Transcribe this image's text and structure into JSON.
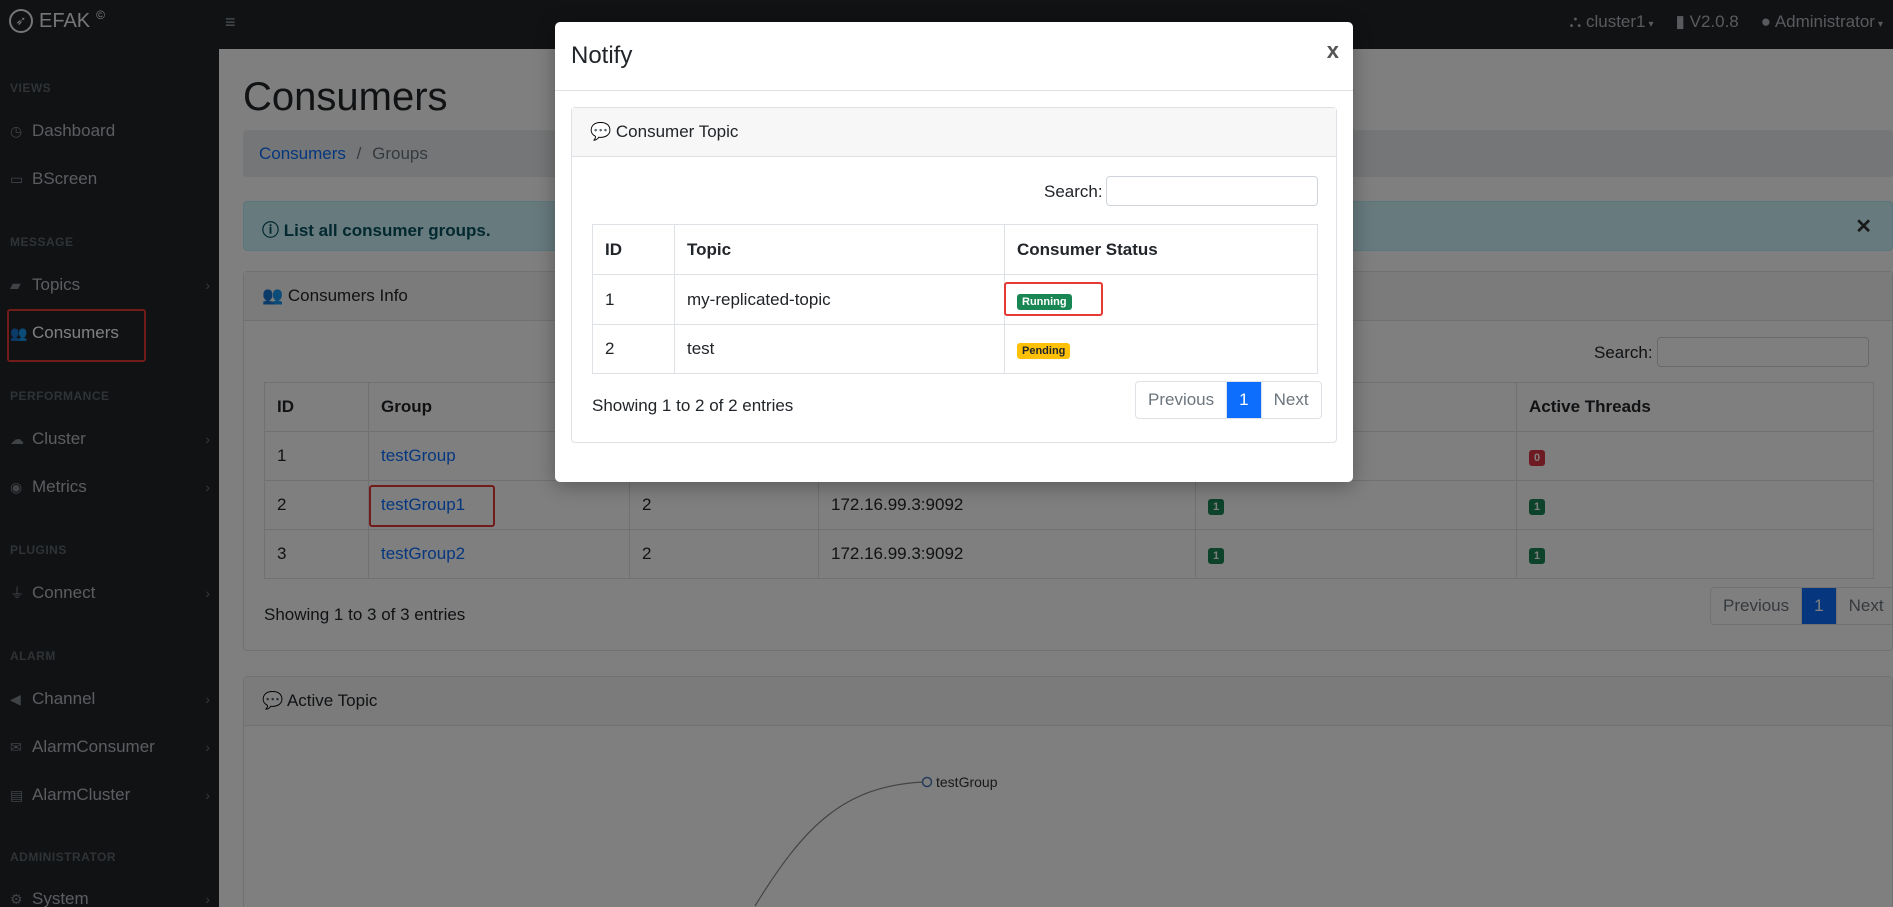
{
  "topbar": {
    "brand": "EFAK",
    "brand_mark": "©",
    "cluster": "cluster1",
    "version": "V2.0.8",
    "user": "Administrator"
  },
  "sidebar": {
    "sections": {
      "views": "VIEWS",
      "message": "MESSAGE",
      "performance": "PERFORMANCE",
      "plugins": "PLUGINS",
      "alarm": "ALARM",
      "administrator": "ADMINISTRATOR"
    },
    "items": {
      "dashboard": "Dashboard",
      "bscreen": "BScreen",
      "topics": "Topics",
      "consumers": "Consumers",
      "cluster": "Cluster",
      "metrics": "Metrics",
      "connect": "Connect",
      "channel": "Channel",
      "alarm_consumer": "AlarmConsumer",
      "alarm_cluster": "AlarmCluster",
      "system": "System"
    }
  },
  "main": {
    "title": "Consumers",
    "breadcrumb": {
      "link": "Consumers",
      "sep": "/",
      "current": "Groups"
    },
    "alert": "List all consumer groups.",
    "consumers_card": {
      "header": "Consumers Info",
      "search_label": "Search:",
      "columns": {
        "id": "ID",
        "group": "Group",
        "active_threads": "Active Threads"
      },
      "rows": [
        {
          "id": "1",
          "group": "testGroup",
          "topics": "",
          "node": "",
          "active_topics": "",
          "active_threads": "0"
        },
        {
          "id": "2",
          "group": "testGroup1",
          "topics": "2",
          "node": "172.16.99.3:9092",
          "active_topics": "1",
          "active_threads": "1"
        },
        {
          "id": "3",
          "group": "testGroup2",
          "topics": "2",
          "node": "172.16.99.3:9092",
          "active_topics": "1",
          "active_threads": "1"
        }
      ],
      "footer": "Showing 1 to 3 of 3 entries",
      "pager": {
        "prev": "Previous",
        "page": "1",
        "next": "Next"
      }
    },
    "active_topic_card": {
      "header": "Active Topic",
      "graph_node": "testGroup"
    }
  },
  "modal": {
    "title": "Notify",
    "close": "x",
    "card_header": "Consumer Topic",
    "search_label": "Search:",
    "columns": {
      "id": "ID",
      "topic": "Topic",
      "status": "Consumer Status"
    },
    "rows": [
      {
        "id": "1",
        "topic": "my-replicated-topic",
        "status": "Running"
      },
      {
        "id": "2",
        "topic": "test",
        "status": "Pending"
      }
    ],
    "footer": "Showing 1 to 2 of 2 entries",
    "pager": {
      "prev": "Previous",
      "page": "1",
      "next": "Next"
    }
  },
  "colors": {
    "accent": "#0d6efd",
    "running": "#198754",
    "pending": "#ffc107",
    "zero": "#dc3545",
    "highlight": "#e53935"
  }
}
